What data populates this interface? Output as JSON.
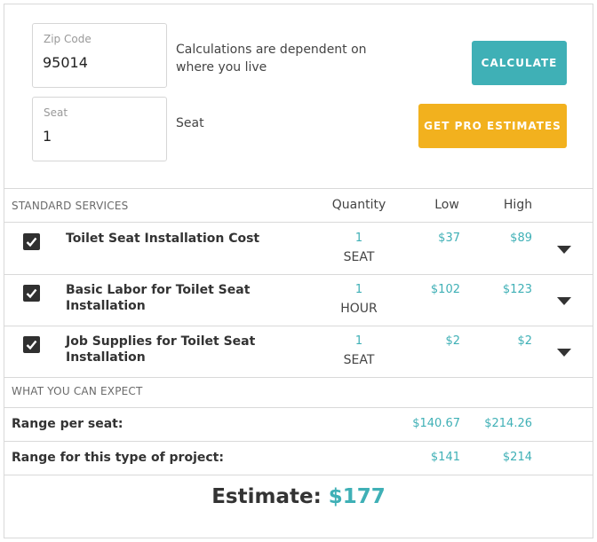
{
  "inputs": {
    "zip": {
      "label": "Zip Code",
      "value": "95014",
      "hint": "Calculations are dependent on where you live"
    },
    "seat": {
      "label": "Seat",
      "value": "1",
      "hint": "Seat"
    }
  },
  "buttons": {
    "calculate": "CALCULATE",
    "pro_estimates": "GET PRO ESTIMATES"
  },
  "colors": {
    "accent_teal": "#3fb0b6",
    "accent_yellow": "#f2b11e"
  },
  "table": {
    "section_label": "STANDARD SERVICES",
    "columns": {
      "quantity": "Quantity",
      "low": "Low",
      "high": "High"
    },
    "rows": [
      {
        "checked": true,
        "name": "Toilet Seat Installation Cost",
        "quantity": "1",
        "unit": "SEAT",
        "low": "$37",
        "high": "$89"
      },
      {
        "checked": true,
        "name": "Basic Labor for Toilet Seat Installation",
        "quantity": "1",
        "unit": "HOUR",
        "low": "$102",
        "high": "$123"
      },
      {
        "checked": true,
        "name": "Job Supplies for Toilet Seat Installation",
        "quantity": "1",
        "unit": "SEAT",
        "low": "$2",
        "high": "$2"
      }
    ]
  },
  "expect": {
    "section_label": "WHAT YOU CAN EXPECT",
    "per_seat": {
      "label": "Range per seat:",
      "low": "$140.67",
      "high": "$214.26"
    },
    "project": {
      "label": "Range for this type of project:",
      "low": "$141",
      "high": "$214"
    }
  },
  "estimate": {
    "label": "Estimate:",
    "value": "$177"
  }
}
